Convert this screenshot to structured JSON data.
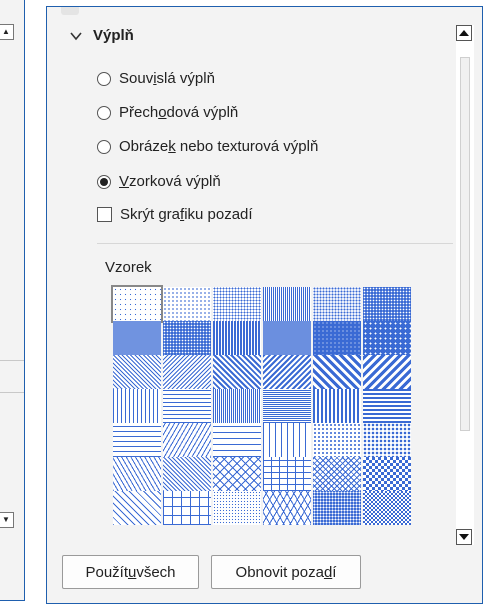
{
  "fill_section": {
    "title": "Výplň",
    "options": [
      {
        "pre": "Souv",
        "u": "i",
        "post": "slá výplň",
        "selected": false
      },
      {
        "pre": "Přech",
        "u": "o",
        "post": "dová výplň",
        "selected": false
      },
      {
        "pre": "Obráze",
        "u": "k",
        "post": " nebo texturová výplň",
        "selected": false
      },
      {
        "pre": "",
        "u": "V",
        "post": "zorková výplň",
        "selected": true
      }
    ],
    "hide_background": {
      "pre": "Skrýt gra",
      "u": "f",
      "post": "iku pozadí",
      "checked": false
    },
    "pattern_label": "Vzorek",
    "accent_color": "#3a6ad4",
    "selected_pattern_index": 0
  },
  "buttons": {
    "apply_all": {
      "pre": "Použít ",
      "u": "u",
      "post": " všech"
    },
    "reset_background": {
      "pre": "Obnovit poza",
      "u": "d",
      "post": "í"
    }
  },
  "icons": {
    "section_toggle": "chevron-down-icon",
    "scroll_up": "arrow-up-icon",
    "scroll_down": "arrow-down-icon"
  }
}
